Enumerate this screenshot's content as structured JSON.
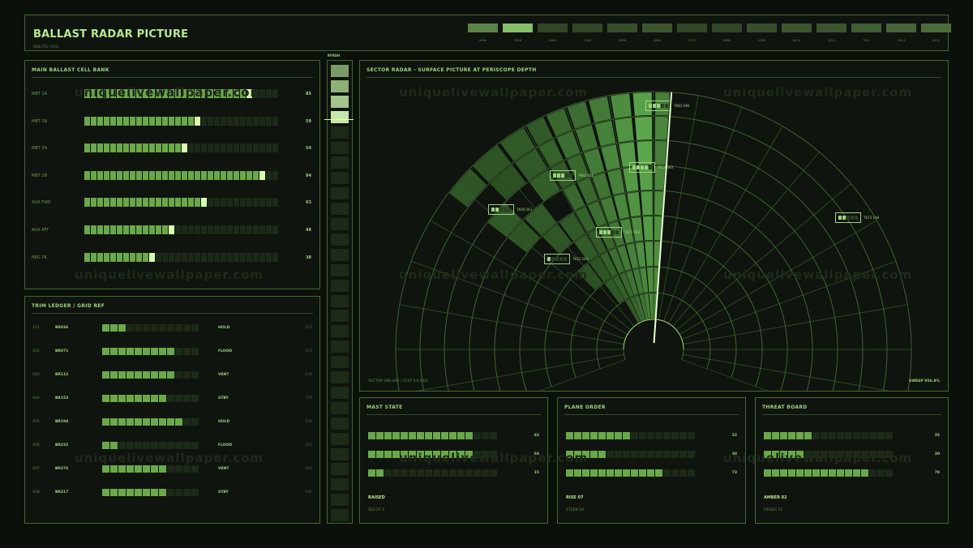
{
  "header": {
    "title": "BALLAST RADAR PICTURE",
    "subtitle": "DIVE-CTL / R-01",
    "tabs": [
      {
        "label": "UB06",
        "level": 0.6
      },
      {
        "label": "TR08",
        "level": 1.0
      },
      {
        "label": "HB82",
        "level": 0.2
      },
      {
        "label": "CA06",
        "level": 0.2
      },
      {
        "label": "DE96",
        "level": 0.25
      },
      {
        "label": "UB85",
        "level": 0.3
      },
      {
        "label": "ST07",
        "level": 0.2
      },
      {
        "label": "HB08",
        "level": 0.2
      },
      {
        "label": "CA89",
        "level": 0.25
      },
      {
        "label": "DE10",
        "level": 0.3
      },
      {
        "label": "SD11",
        "level": 0.3
      },
      {
        "label": "TR12",
        "level": 0.35
      },
      {
        "label": "UB13",
        "level": 0.4
      },
      {
        "label": "DE14",
        "level": 0.45
      }
    ]
  },
  "ballast": {
    "title": "MAIN BALLAST CELL BANK",
    "rows": [
      {
        "label": "MBT 1A",
        "value": "85",
        "level": 0.85
      },
      {
        "label": "MBT 1B",
        "value": "59",
        "level": 0.59
      },
      {
        "label": "MBT 2A",
        "value": "54",
        "level": 0.54
      },
      {
        "label": "MBT 2B",
        "value": "94",
        "level": 0.94
      },
      {
        "label": "AUX FWD",
        "value": "63",
        "level": 0.63
      },
      {
        "label": "AUX AFT",
        "value": "48",
        "level": 0.48
      },
      {
        "label": "NEG TK",
        "value": "38",
        "level": 0.38
      }
    ]
  },
  "trim": {
    "title": "TRIM LEDGER / GRID REF",
    "rows": [
      {
        "id": "X31",
        "grid": "BR036",
        "level": 0.25,
        "action": "HOLD",
        "code": "S70"
      },
      {
        "id": "X32",
        "grid": "BR071",
        "level": 0.75,
        "action": "FLOOD",
        "code": "E25"
      },
      {
        "id": "X43",
        "grid": "BR112",
        "level": 0.75,
        "action": "VENT",
        "code": "E44"
      },
      {
        "id": "X44",
        "grid": "BR153",
        "level": 0.65,
        "action": "STBY",
        "code": "F56"
      },
      {
        "id": "X35",
        "grid": "BR194",
        "level": 0.8,
        "action": "HOLD",
        "code": "S38"
      },
      {
        "id": "X56",
        "grid": "BR235",
        "level": 0.15,
        "action": "FLOOD",
        "code": "E65"
      },
      {
        "id": "X47",
        "grid": "BR276",
        "level": 0.7,
        "action": "VENT",
        "code": "E64"
      },
      {
        "id": "X58",
        "grid": "BR317",
        "level": 0.65,
        "action": "STBY",
        "code": "F06"
      }
    ]
  },
  "rfrsh": {
    "label": "RFRSH",
    "level": 0.24
  },
  "radar": {
    "title": "SECTOR RADAR - SURFACE PICTURE AT PERISCOPE DEPTH",
    "footer_left": "SECTOR 286-046 / STEP 0.8 DEG",
    "footer_right": "SWEEP 056.8%",
    "contacts": [
      {
        "label": "TK83 096",
        "fill": 3
      },
      {
        "label": "TK92 041",
        "fill": 3
      },
      {
        "label": "TK54 063",
        "fill": 4
      },
      {
        "label": "TK06 043",
        "fill": 2
      },
      {
        "label": "TK07 064",
        "fill": 3
      },
      {
        "label": "TK21 044",
        "fill": 1
      },
      {
        "label": "TK73 148",
        "fill": 2
      }
    ]
  },
  "mast": {
    "title": "MAST STATE",
    "rows": [
      {
        "value": "82",
        "level": 0.82
      },
      {
        "value": "84",
        "level": 0.84
      },
      {
        "value": "15",
        "level": 0.15
      }
    ],
    "status": "RAISED",
    "foot": "SEA ST 3"
  },
  "plane": {
    "title": "PLANE ORDER",
    "rows": [
      {
        "value": "52",
        "level": 0.52
      },
      {
        "value": "30",
        "level": 0.3
      },
      {
        "value": "73",
        "level": 0.73
      }
    ],
    "status": "RISE 07",
    "foot": "STERN 04"
  },
  "threat": {
    "title": "THREAT BOARD",
    "rows": [
      {
        "value": "35",
        "level": 0.35
      },
      {
        "value": "30",
        "level": 0.3
      },
      {
        "value": "79",
        "level": 0.79
      }
    ],
    "status": "AMBER 02",
    "foot": "ORDER 11"
  },
  "watermark": "uniquelivewallpaper.com",
  "colors": {
    "accent": "#9ed27e",
    "bright": "#c8f5a0",
    "dim": "#1c2a18",
    "border": "#3f6a32"
  }
}
